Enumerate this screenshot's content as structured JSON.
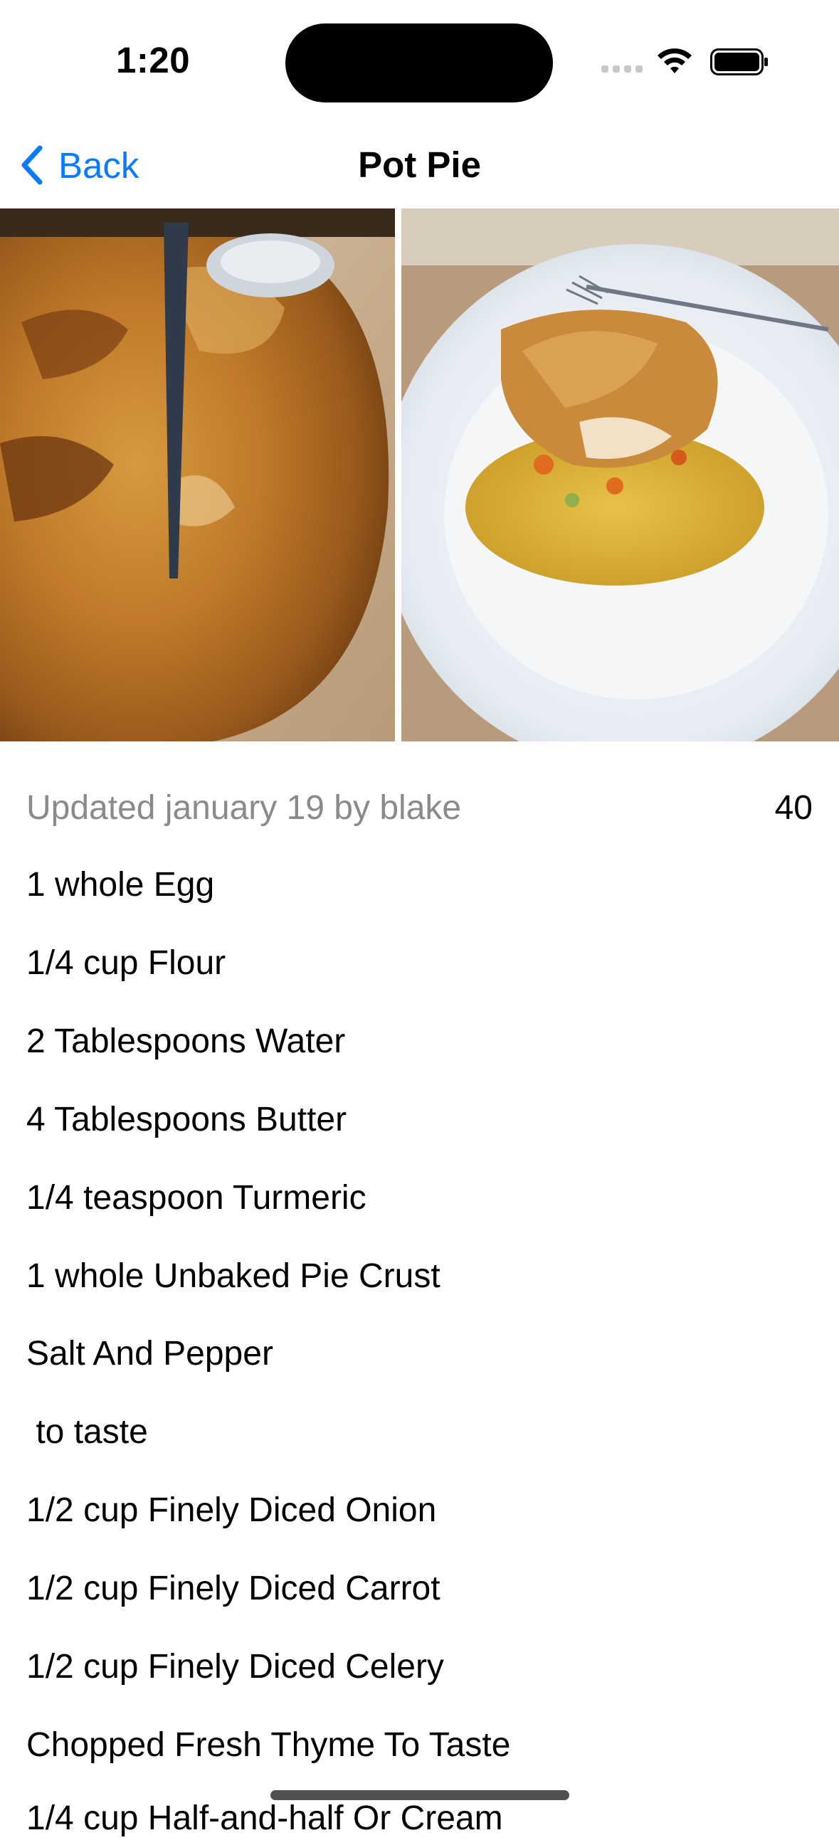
{
  "status_bar": {
    "time": "1:20",
    "icons": [
      "cellular-signal-icon",
      "wifi-icon",
      "battery-icon"
    ]
  },
  "nav": {
    "back_label": "Back",
    "title": "Pot Pie",
    "accent_color": "#0a7aff"
  },
  "photos": [
    {
      "name": "pot-pie-dish-photo"
    },
    {
      "name": "pot-pie-plated-photo"
    }
  ],
  "detail": {
    "updated": "Updated january 19 by blake",
    "count": "40"
  },
  "ingredients": [
    "1 whole Egg",
    "1/4 cup Flour",
    "2 Tablespoons Water",
    "4 Tablespoons Butter",
    "1/4 teaspoon Turmeric",
    "1 whole Unbaked Pie Crust",
    "Salt And Pepper",
    " to taste",
    "1/2 cup Finely Diced Onion",
    "1/2 cup Finely Diced Carrot",
    "1/2 cup Finely Diced Celery",
    "Chopped Fresh Thyme To Taste",
    "1/4 cup Half-and-half Or Cream"
  ]
}
